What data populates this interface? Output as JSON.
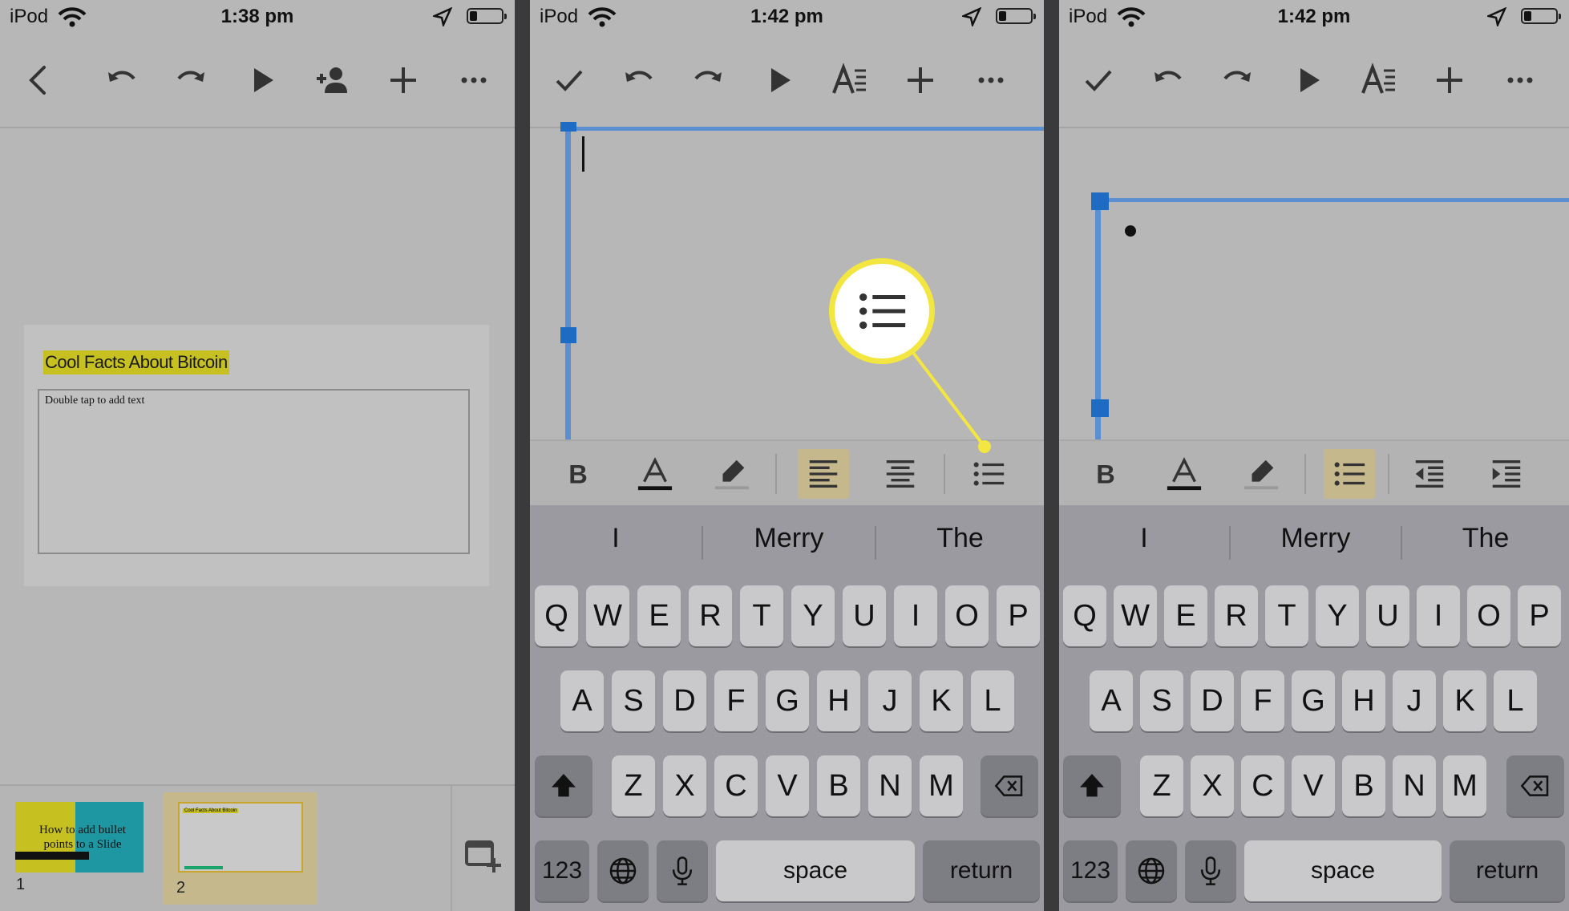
{
  "panels": [
    {
      "status": {
        "carrier": "iPod",
        "time": "1:38 pm"
      }
    },
    {
      "status": {
        "carrier": "iPod",
        "time": "1:42 pm"
      }
    },
    {
      "status": {
        "carrier": "iPod",
        "time": "1:42 pm"
      }
    }
  ],
  "slide_editor": {
    "title": "Cool Facts About Bitcoin",
    "body_placeholder": "Double tap to add text"
  },
  "filmstrip": {
    "slides": [
      {
        "number": "1",
        "thumb_text": "How to add bullet points to a Slide"
      },
      {
        "number": "2",
        "thumb_text": "Cool Facts About Bitcoin"
      }
    ]
  },
  "keyboard": {
    "suggestions": [
      "I",
      "Merry",
      "The"
    ],
    "row1": [
      "Q",
      "W",
      "E",
      "R",
      "T",
      "Y",
      "U",
      "I",
      "O",
      "P"
    ],
    "row2": [
      "A",
      "S",
      "D",
      "F",
      "G",
      "H",
      "J",
      "K",
      "L"
    ],
    "row3": [
      "Z",
      "X",
      "C",
      "V",
      "B",
      "N",
      "M"
    ],
    "numbers_label": "123",
    "space_label": "space",
    "return_label": "return"
  },
  "colors": {
    "highlight": "#c6c021",
    "selection_blue": "#1d6bc2",
    "callout_yellow": "#f3e640",
    "active_button": "#c5b88c"
  },
  "icons": {
    "toolbar_p1": [
      "back-icon",
      "undo-icon",
      "redo-icon",
      "play-icon",
      "add-person-icon",
      "plus-icon",
      "more-icon"
    ],
    "toolbar_p2": [
      "check-icon",
      "undo-icon",
      "redo-icon",
      "play-icon",
      "text-format-icon",
      "plus-icon",
      "more-icon"
    ],
    "format_p2": [
      "bold-icon",
      "text-color-icon",
      "highlight-icon",
      "align-left-icon",
      "align-center-icon",
      "bulleted-list-icon"
    ],
    "format_p3": [
      "bold-icon",
      "text-color-icon",
      "highlight-icon",
      "bulleted-list-icon",
      "decrease-indent-icon",
      "increase-indent-icon"
    ]
  }
}
